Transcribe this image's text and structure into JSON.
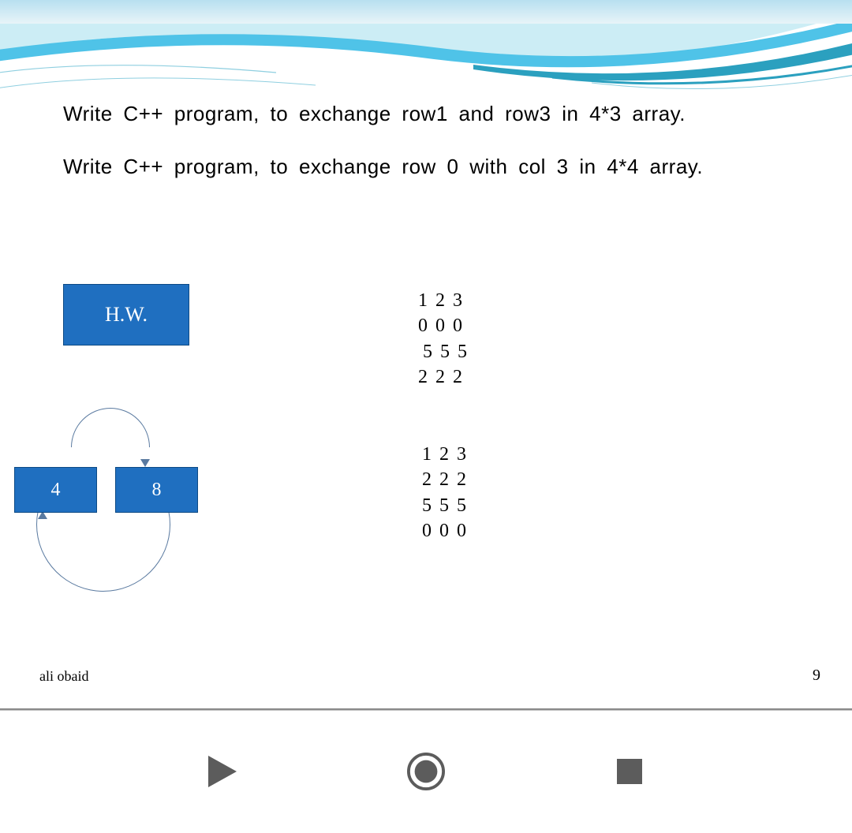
{
  "slide": {
    "task1": "Write C++ program, to exchange row1 and row3 in 4*3 array.",
    "task2": "Write C++ program, to exchange row 0 with col 3 in 4*4 array.",
    "hw_label": "H.W.",
    "matrix1": {
      "r0": "1 2 3",
      "r1": "0 0 0",
      "r2": "5 5 5",
      "r3": "2 2 2"
    },
    "matrix2": {
      "r0": "1 2 3",
      "r1": "2 2 2",
      "r2": "5 5 5",
      "r3": "0 0 0"
    },
    "swap": {
      "a": "4",
      "b": "8"
    },
    "author": "ali obaid",
    "page": "9"
  },
  "nav": {
    "play": "play-icon",
    "record": "record-icon",
    "stop": "stop-icon"
  },
  "colors": {
    "box_blue": "#1f6fc0",
    "wave_cyan": "#4fc3e8",
    "wave_teal": "#2ba0bf",
    "nav_gray": "#5c5c5c"
  }
}
